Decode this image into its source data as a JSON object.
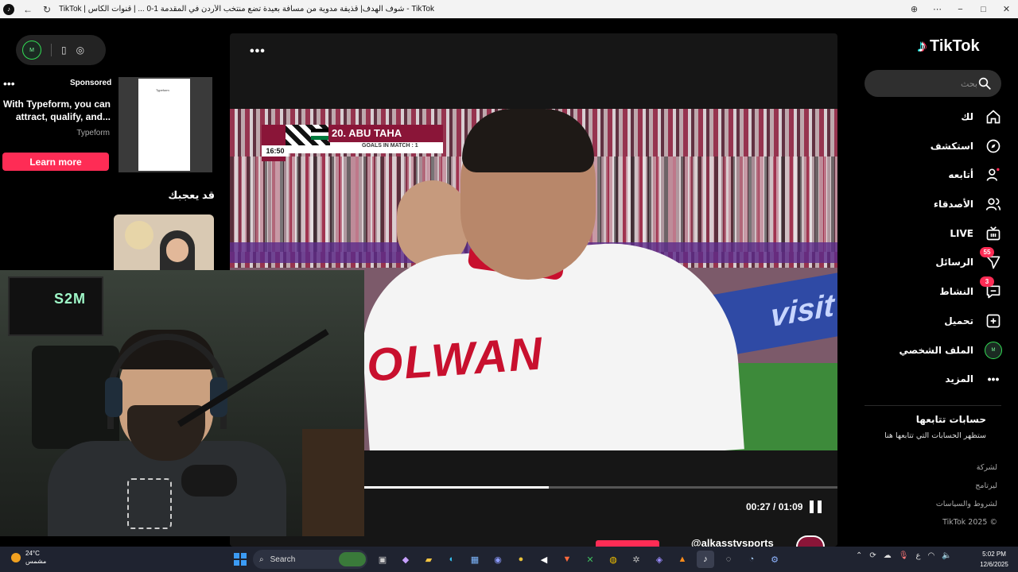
{
  "window": {
    "title": "TikTok | شوف الهدف| قذيفة مدوية من مسافة بعيدة تضع منتخب الأردن في المقدمة 1-0 ... | قنوات الكأس - TikTok",
    "controls": [
      "−",
      "□",
      "✕"
    ]
  },
  "left": {
    "ad": {
      "sponsored": "Sponsored",
      "text": "With Typeform, you can attract, qualify, and...",
      "brand": "Typeform",
      "cta": "Learn more",
      "thumb_label": "Typeform"
    },
    "you_may_like": "قد يعجبك"
  },
  "webcam": {
    "neon": "S2M"
  },
  "video": {
    "overlay": {
      "player_name": "20. ABU TAHA",
      "goals": "GOALS IN MATCH : 1",
      "match_time": "16:50"
    },
    "jersey_name": "OLWAN",
    "board_text": "visit",
    "current_time": "00:27",
    "duration": "01:09",
    "time_sep": " / ",
    "progress": 0.39,
    "author_handle": "@alkasstvsports"
  },
  "sidebar": {
    "logo": "TikTok",
    "search_placeholder": "بحث",
    "nav": [
      {
        "label": "لك",
        "icon": "home-icon"
      },
      {
        "label": "استكشف",
        "icon": "explore-icon"
      },
      {
        "label": "أتابعه",
        "icon": "following-icon"
      },
      {
        "label": "الأصدقاء",
        "icon": "friends-icon"
      },
      {
        "label": "LIVE",
        "icon": "live-icon"
      },
      {
        "label": "الرسائل",
        "icon": "messages-icon",
        "badge": "55"
      },
      {
        "label": "النشاط",
        "icon": "activity-icon",
        "badge": "3"
      },
      {
        "label": "تحميل",
        "icon": "upload-icon"
      },
      {
        "label": "الملف الشخصي",
        "icon": "profile-avatar"
      },
      {
        "label": "المزيد",
        "icon": "more-icon"
      }
    ],
    "following_title": "حسابات تتابعها",
    "following_sub": "ستظهر الحسابات التي تتابعها هنا",
    "footer": [
      "لشركة",
      "ليرتامج",
      "لشروط والسياسات",
      "TikTok 2025 ©"
    ]
  },
  "taskbar": {
    "temperature": "24°C",
    "weather": "مشمس",
    "search_label": "Search",
    "lang": "ع",
    "time": "5:02 PM",
    "date": "12/6/2025"
  },
  "colors": {
    "accent": "#fe2c55",
    "tiktok_cyan": "#25f4ee",
    "jordan_red": "#c8102e",
    "qatar_maroon": "#8a1538"
  }
}
